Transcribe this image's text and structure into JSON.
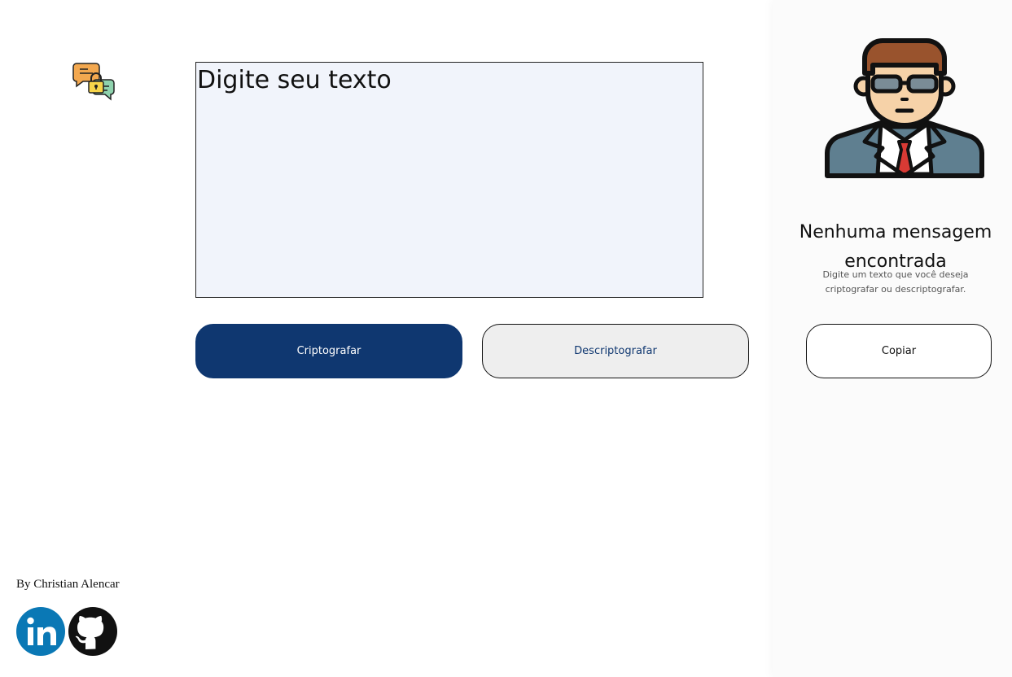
{
  "main": {
    "input_placeholder": "Digite seu texto",
    "encrypt_label": "Criptografar",
    "decrypt_label": "Descriptografar"
  },
  "output": {
    "title": "Nenhuma mensagem encontrada",
    "description": "Digite um texto que você deseja criptografar ou descriptografar.",
    "copy_label": "Copiar"
  },
  "footer": {
    "author": "By Christian Alencar",
    "links": [
      {
        "name": "linkedin-icon"
      },
      {
        "name": "github-icon"
      }
    ]
  },
  "colors": {
    "primary": "#0f3770",
    "input_bg": "#f1f4fb",
    "secondary_button_bg": "#eeeeee",
    "linkedin": "#0a78b5"
  }
}
